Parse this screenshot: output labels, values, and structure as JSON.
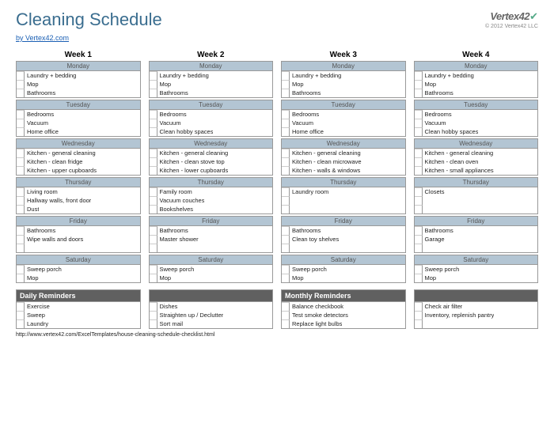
{
  "title": "Cleaning Schedule",
  "byline": "by Vertex42.com",
  "brand": {
    "name": "Vertex42",
    "copyright": "© 2012 Vertex42 LLC"
  },
  "weeks": [
    {
      "title": "Week 1",
      "days": [
        {
          "name": "Monday",
          "tasks": [
            "Laundry + bedding",
            "Mop",
            "Bathrooms"
          ]
        },
        {
          "name": "Tuesday",
          "tasks": [
            "Bedrooms",
            "Vacuum",
            "Home office"
          ]
        },
        {
          "name": "Wednesday",
          "tasks": [
            "Kitchen - general cleaning",
            "Kitchen - clean fridge",
            "Kitchen - upper cupboards"
          ]
        },
        {
          "name": "Thursday",
          "tasks": [
            "Living room",
            "Hallway walls, front door",
            "Dust"
          ]
        },
        {
          "name": "Friday",
          "tasks": [
            "Bathrooms",
            "Wipe walls and doors",
            ""
          ]
        },
        {
          "name": "Saturday",
          "tasks": [
            "Sweep porch",
            "Mop"
          ]
        }
      ]
    },
    {
      "title": "Week 2",
      "days": [
        {
          "name": "Monday",
          "tasks": [
            "Laundry + bedding",
            "Mop",
            "Bathrooms"
          ]
        },
        {
          "name": "Tuesday",
          "tasks": [
            "Bedrooms",
            "Vacuum",
            "Clean hobby spaces"
          ]
        },
        {
          "name": "Wednesday",
          "tasks": [
            "Kitchen - general cleaning",
            "Kitchen - clean stove top",
            "Kitchen - lower cupboards"
          ]
        },
        {
          "name": "Thursday",
          "tasks": [
            "Family room",
            "Vacuum couches",
            "Bookshelves"
          ]
        },
        {
          "name": "Friday",
          "tasks": [
            "Bathrooms",
            "Master shower",
            ""
          ]
        },
        {
          "name": "Saturday",
          "tasks": [
            "Sweep porch",
            "Mop"
          ]
        }
      ]
    },
    {
      "title": "Week 3",
      "days": [
        {
          "name": "Monday",
          "tasks": [
            "Laundry + bedding",
            "Mop",
            "Bathrooms"
          ]
        },
        {
          "name": "Tuesday",
          "tasks": [
            "Bedrooms",
            "Vacuum",
            "Home office"
          ]
        },
        {
          "name": "Wednesday",
          "tasks": [
            "Kitchen - general cleaning",
            "Kitchen - clean microwave",
            "Kitchen - walls & windows"
          ]
        },
        {
          "name": "Thursday",
          "tasks": [
            "Laundry room",
            "",
            ""
          ]
        },
        {
          "name": "Friday",
          "tasks": [
            "Bathrooms",
            "Clean toy shelves",
            ""
          ]
        },
        {
          "name": "Saturday",
          "tasks": [
            "Sweep porch",
            "Mop"
          ]
        }
      ]
    },
    {
      "title": "Week 4",
      "days": [
        {
          "name": "Monday",
          "tasks": [
            "Laundry + bedding",
            "Mop",
            "Bathrooms"
          ]
        },
        {
          "name": "Tuesday",
          "tasks": [
            "Bedrooms",
            "Vacuum",
            "Clean hobby spaces"
          ]
        },
        {
          "name": "Wednesday",
          "tasks": [
            "Kitchen - general cleaning",
            "Kitchen - clean oven",
            "Kitchen - small appliances"
          ]
        },
        {
          "name": "Thursday",
          "tasks": [
            "Closets",
            "",
            ""
          ]
        },
        {
          "name": "Friday",
          "tasks": [
            "Bathrooms",
            "Garage",
            ""
          ]
        },
        {
          "name": "Saturday",
          "tasks": [
            "Sweep porch",
            "Mop"
          ]
        }
      ]
    }
  ],
  "daily_reminders": {
    "title": "Daily Reminders",
    "cols": [
      [
        "Exercise",
        "Sweep",
        "Laundry"
      ],
      [
        "Dishes",
        "Straighten up / Declutter",
        "Sort mail"
      ]
    ]
  },
  "monthly_reminders": {
    "title": "Monthly Reminders",
    "cols": [
      [
        "Balance checkbook",
        "Test smoke detectors",
        "Replace light bulbs"
      ],
      [
        "Check air filter",
        "Inventory, replenish pantry",
        ""
      ]
    ]
  },
  "footer": "http://www.vertex42.com/ExcelTemplates/house-cleaning-schedule-checklist.html"
}
